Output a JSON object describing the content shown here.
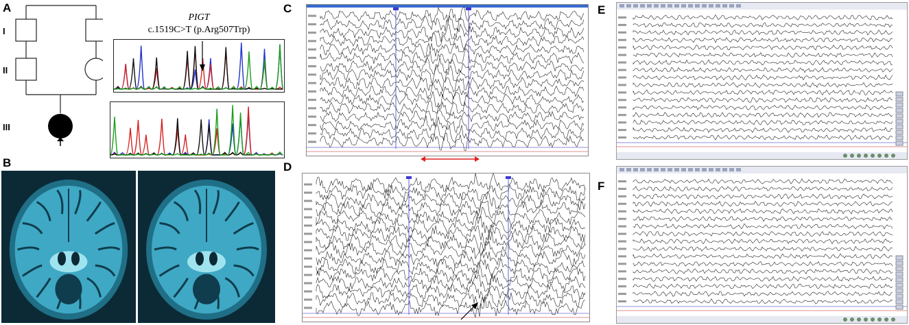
{
  "panels": {
    "A": "A",
    "B": "B",
    "C": "C",
    "D": "D",
    "E": "E",
    "F": "F"
  },
  "pedigree": {
    "generations": [
      "I",
      "II",
      "III"
    ]
  },
  "sequencing": {
    "gene": "PIGT",
    "variant": "c.1519C>T (p.Arg507Trp)"
  },
  "colors": {
    "trace_A": "#1a9e1a",
    "trace_C": "#2233cc",
    "trace_G": "#111111",
    "trace_T": "#d42020",
    "eeg_marker": "#3a3ad0",
    "annotation_red": "#e02020",
    "mri_bg": "#0c2a36",
    "mri_tissue": "#3fa8c4"
  }
}
